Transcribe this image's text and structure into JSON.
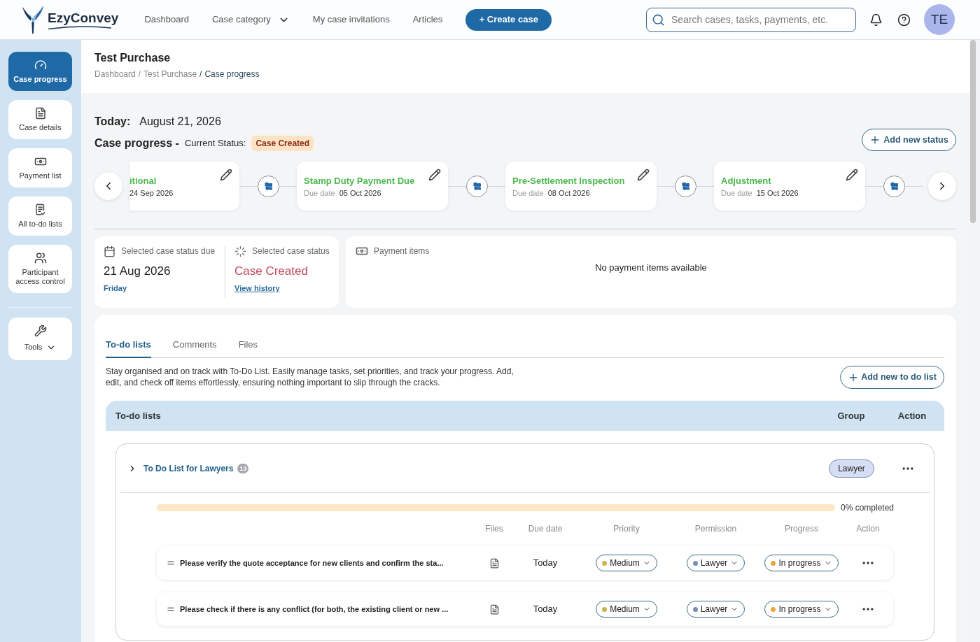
{
  "header": {
    "logo": "EzyConvey",
    "nav": [
      {
        "label": "Dashboard",
        "kind": "link"
      },
      {
        "label": "Case category",
        "kind": "dropdown"
      },
      {
        "label": "My case invitations",
        "kind": "link"
      },
      {
        "label": "Articles",
        "kind": "link"
      }
    ],
    "create_button": "+ Create case",
    "search": {
      "placeholder": "Search cases, tasks, payments, etc."
    },
    "avatar": "TE"
  },
  "sidebar": {
    "items": [
      {
        "label": "Case progress",
        "selected": true
      },
      {
        "label": "Case details",
        "selected": false
      },
      {
        "label": "Payment list",
        "selected": false
      },
      {
        "label": "All to-do lists",
        "selected": false
      },
      {
        "label": "Participant access control",
        "selected": false
      }
    ],
    "tools": "Tools"
  },
  "page": {
    "title": "Test Purchase",
    "breadcrumb": {
      "separator": "/",
      "items": [
        {
          "label": "Dashboard",
          "current": false
        },
        {
          "label": "Test Purchase",
          "current": false
        },
        {
          "label": "Case progress",
          "current": true
        }
      ]
    }
  },
  "today": {
    "label": "Today:",
    "date": "August 21, 2026"
  },
  "case_progress": {
    "title": "Case progress -",
    "status_label": "Current Status:",
    "status": "Case Created",
    "add_button": "Add new status"
  },
  "timeline": [
    {
      "title": "itional",
      "due_date": "24 Sep 2026",
      "cut_off": true
    },
    {
      "title": "Stamp Duty Payment Due",
      "due_label": "Due date",
      "due_date": "05 Oct 2026",
      "cut_off": false
    },
    {
      "title": "Pre-Settlement Inspection",
      "due_label": "Due date",
      "due_date": "08 Oct 2026",
      "cut_off": false
    },
    {
      "title": "Adjustment",
      "due_label": "Due date",
      "due_date": "15 Oct 2026",
      "cut_off": false
    }
  ],
  "selected_status": {
    "due_label": "Selected case status due",
    "due_date": "21 Aug 2026",
    "weekday": "Friday",
    "status_label": "Selected case status",
    "status": "Case Created",
    "history_link": "View history"
  },
  "payment_items": {
    "label": "Payment items",
    "empty_message": "No payment items available"
  },
  "tabs": [
    {
      "label": "To-do lists",
      "selected": true
    },
    {
      "label": "Comments",
      "selected": false
    },
    {
      "label": "Files",
      "selected": false
    }
  ],
  "todo": {
    "description": "Stay organised and on track with To-Do List. Easily manage tasks, set priorities, and track your progress. Add, edit, and check off items effortlessly, ensuring nothing important to slip through the cracks.",
    "add_button": "Add new to do list",
    "columns": [
      "To-do lists",
      "Group",
      "Action"
    ],
    "lists": [
      {
        "name": "To Do List for Lawyers",
        "count": "13",
        "group": "Lawyer",
        "progress": {
          "level": 0,
          "label": "0% completed"
        },
        "task_columns": [
          "Files",
          "Due date",
          "Priority",
          "Permission",
          "Progress",
          "Action"
        ],
        "tasks": [
          {
            "title": "Please verify the quote acceptance for new clients and confirm the sta...",
            "due": "Today",
            "priority": {
              "label": "Medium",
              "color": "#c9b64a"
            },
            "permission": {
              "label": "Lawyer",
              "color": "#7890b5"
            },
            "progress": {
              "label": "In progress",
              "color": "#f0a43c"
            }
          },
          {
            "title": "Please check if there is any conflict (for both, the existing client or new ...",
            "due": "Today",
            "priority": {
              "label": "Medium",
              "color": "#c9b64a"
            },
            "permission": {
              "label": "Lawyer",
              "color": "#7890b5"
            },
            "progress": {
              "label": "In progress",
              "color": "#f0a43c"
            }
          }
        ]
      }
    ]
  }
}
